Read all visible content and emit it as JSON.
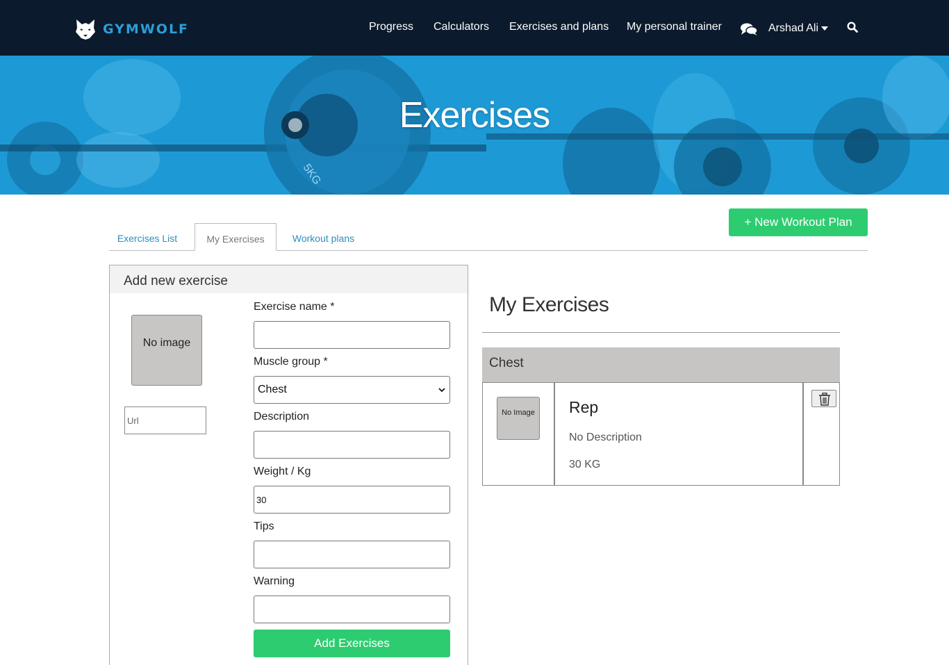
{
  "brand": {
    "name": "GYMWOLF",
    "accent": "#2a9fd8"
  },
  "nav": {
    "links": [
      "Progress",
      "Calculators",
      "Exercises and plans",
      "My personal trainer"
    ],
    "user": "Arshad Ali",
    "icons": [
      "chat-icon",
      "search-icon",
      "wolf-logo"
    ]
  },
  "hero": {
    "title": "Exercises"
  },
  "tabs": [
    {
      "label": "Exercises List",
      "active": false
    },
    {
      "label": "My Exercises",
      "active": true
    },
    {
      "label": "Workout plans",
      "active": false
    }
  ],
  "new_plan_button": "+ New Workout Plan",
  "add_form": {
    "title": "Add new exercise",
    "no_image": "No image",
    "url_placeholder": "Url",
    "fields": {
      "name": {
        "label": "Exercise name *",
        "value": ""
      },
      "group": {
        "label": "Muscle group *",
        "value": "Chest"
      },
      "description": {
        "label": "Description",
        "value": ""
      },
      "weight": {
        "label": "Weight / Kg",
        "value": "30"
      },
      "tips": {
        "label": "Tips",
        "value": ""
      },
      "warning": {
        "label": "Warning",
        "value": ""
      }
    },
    "submit": "Add Exercises"
  },
  "my_exercises": {
    "title": "My Exercises",
    "groups": [
      {
        "name": "Chest",
        "items": [
          {
            "thumb": "No Image",
            "name": "Rep",
            "description": "No Description",
            "weight": "30 KG"
          }
        ]
      }
    ]
  },
  "colors": {
    "navbar": "#0b1a2c",
    "hero": "#1b9ad6",
    "button": "#2ecc71",
    "link": "#2a8fc0"
  }
}
